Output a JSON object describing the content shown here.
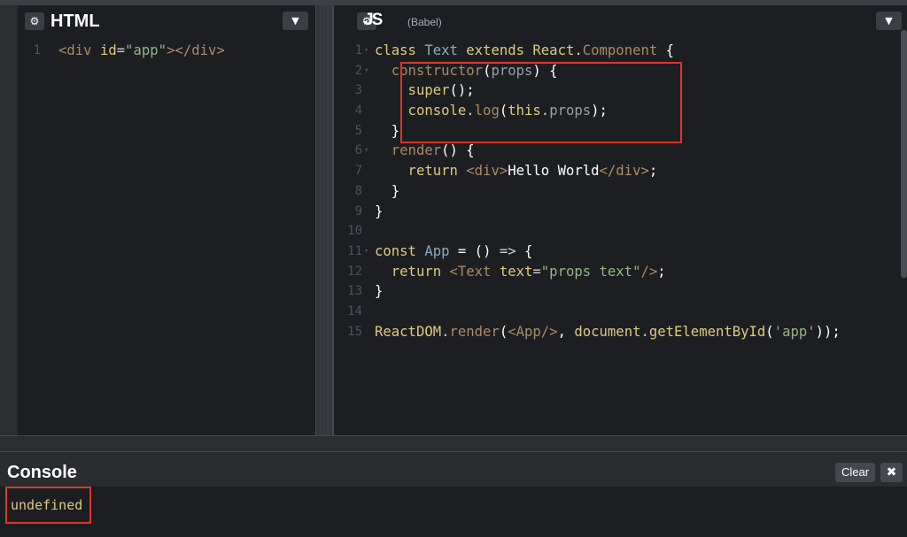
{
  "html_pane": {
    "title": "HTML",
    "settings_icon": "gear-icon",
    "collapse_icon": "chevron-down-icon",
    "lines": [
      {
        "n": "1",
        "fold": "",
        "tokens": [
          {
            "t": "<div",
            "c": "c-tag"
          },
          {
            "t": " ",
            "c": "c-plain"
          },
          {
            "t": "id",
            "c": "c-attr"
          },
          {
            "t": "=",
            "c": "c-plain"
          },
          {
            "t": "\"app\"",
            "c": "c-str"
          },
          {
            "t": "></div>",
            "c": "c-tag"
          }
        ]
      }
    ]
  },
  "js_pane": {
    "title": "JS",
    "subtitle": "(Babel)",
    "settings_icon": "gear-icon",
    "collapse_icon": "chevron-down-icon",
    "lines": [
      {
        "n": "1",
        "fold": "▾",
        "tokens": [
          {
            "t": "class ",
            "c": "c-kw"
          },
          {
            "t": "Text",
            "c": "c-cls"
          },
          {
            "t": " extends ",
            "c": "c-kw"
          },
          {
            "t": "React",
            "c": "c-kw"
          },
          {
            "t": ".",
            "c": "c-plain"
          },
          {
            "t": "Component",
            "c": "c-def"
          },
          {
            "t": " {",
            "c": "c-var"
          }
        ]
      },
      {
        "n": "2",
        "fold": "▾",
        "tokens": [
          {
            "t": "  constructor",
            "c": "c-def"
          },
          {
            "t": "(",
            "c": "c-var"
          },
          {
            "t": "props",
            "c": "c-prop"
          },
          {
            "t": ") {",
            "c": "c-var"
          }
        ]
      },
      {
        "n": "3",
        "fold": "",
        "tokens": [
          {
            "t": "    super",
            "c": "c-kw"
          },
          {
            "t": "();",
            "c": "c-var"
          }
        ]
      },
      {
        "n": "4",
        "fold": "",
        "tokens": [
          {
            "t": "    console",
            "c": "c-kw"
          },
          {
            "t": ".",
            "c": "c-plain"
          },
          {
            "t": "log",
            "c": "c-def"
          },
          {
            "t": "(",
            "c": "c-var"
          },
          {
            "t": "this",
            "c": "c-kw"
          },
          {
            "t": ".",
            "c": "c-plain"
          },
          {
            "t": "props",
            "c": "c-prop"
          },
          {
            "t": ");",
            "c": "c-var"
          }
        ]
      },
      {
        "n": "5",
        "fold": "",
        "tokens": [
          {
            "t": "  }",
            "c": "c-var"
          }
        ]
      },
      {
        "n": "6",
        "fold": "▾",
        "tokens": [
          {
            "t": "  render",
            "c": "c-def"
          },
          {
            "t": "() {",
            "c": "c-var"
          }
        ]
      },
      {
        "n": "7",
        "fold": "",
        "tokens": [
          {
            "t": "    return ",
            "c": "c-kw"
          },
          {
            "t": "<div>",
            "c": "c-tag"
          },
          {
            "t": "Hello World",
            "c": "c-var"
          },
          {
            "t": "</div>",
            "c": "c-tag"
          },
          {
            "t": ";",
            "c": "c-var"
          }
        ]
      },
      {
        "n": "8",
        "fold": "",
        "tokens": [
          {
            "t": "  }",
            "c": "c-var"
          }
        ]
      },
      {
        "n": "9",
        "fold": "",
        "tokens": [
          {
            "t": "}",
            "c": "c-var"
          }
        ]
      },
      {
        "n": "10",
        "fold": "",
        "tokens": []
      },
      {
        "n": "11",
        "fold": "▾",
        "tokens": [
          {
            "t": "const ",
            "c": "c-kw"
          },
          {
            "t": "App",
            "c": "c-cls"
          },
          {
            "t": " = () ",
            "c": "c-var"
          },
          {
            "t": "=>",
            "c": "c-plain"
          },
          {
            "t": " {",
            "c": "c-var"
          }
        ]
      },
      {
        "n": "12",
        "fold": "",
        "tokens": [
          {
            "t": "  return ",
            "c": "c-kw"
          },
          {
            "t": "<Text",
            "c": "c-tag"
          },
          {
            "t": " ",
            "c": "c-plain"
          },
          {
            "t": "text",
            "c": "c-attr"
          },
          {
            "t": "=",
            "c": "c-plain"
          },
          {
            "t": "\"props text\"",
            "c": "c-str"
          },
          {
            "t": "/>",
            "c": "c-tag"
          },
          {
            "t": ";",
            "c": "c-var"
          }
        ]
      },
      {
        "n": "13",
        "fold": "",
        "tokens": [
          {
            "t": "}",
            "c": "c-var"
          }
        ]
      },
      {
        "n": "14",
        "fold": "",
        "tokens": []
      },
      {
        "n": "15",
        "fold": "",
        "tokens": [
          {
            "t": "ReactDOM",
            "c": "c-kw"
          },
          {
            "t": ".",
            "c": "c-plain"
          },
          {
            "t": "render",
            "c": "c-def"
          },
          {
            "t": "(",
            "c": "c-var"
          },
          {
            "t": "<App/>",
            "c": "c-tag"
          },
          {
            "t": ", ",
            "c": "c-var"
          },
          {
            "t": "document",
            "c": "c-kw"
          },
          {
            "t": ".",
            "c": "c-plain"
          },
          {
            "t": "getElementById",
            "c": "c-kw"
          },
          {
            "t": "(",
            "c": "c-var"
          },
          {
            "t": "'app'",
            "c": "c-str"
          },
          {
            "t": "));",
            "c": "c-var"
          }
        ]
      }
    ]
  },
  "console": {
    "title": "Console",
    "clear_label": "Clear",
    "close_icon": "close-icon",
    "output": "undefined"
  },
  "colors": {
    "highlight": "#d9382c",
    "background": "#1d1e22",
    "keyword": "#ddca7e"
  }
}
